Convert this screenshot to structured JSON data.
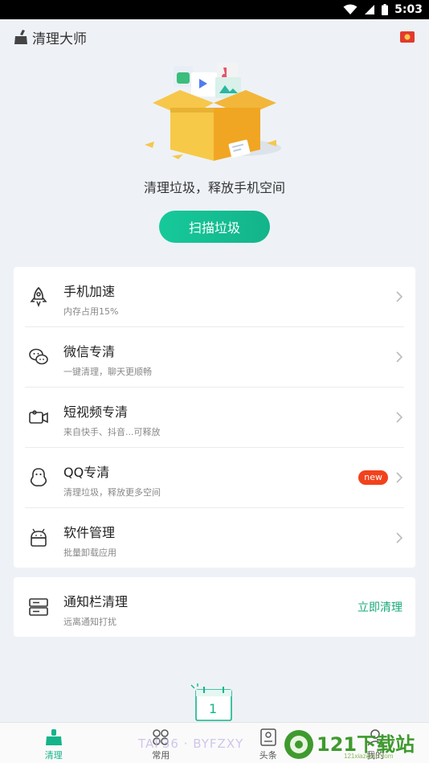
{
  "status_bar": {
    "time": "5:03"
  },
  "app_bar": {
    "title": "清理大师"
  },
  "hero": {
    "slogan": "清理垃圾，释放手机空间",
    "scan_button": "扫描垃圾"
  },
  "features": [
    {
      "title": "手机加速",
      "subtitle": "内存占用15%",
      "icon": "rocket-icon"
    },
    {
      "title": "微信专清",
      "subtitle": "一键清理，聊天更顺畅",
      "icon": "wechat-icon"
    },
    {
      "title": "短视频专清",
      "subtitle": "来自快手、抖音...可释放",
      "icon": "video-camera-icon"
    },
    {
      "title": "QQ专清",
      "subtitle": "清理垃圾，释放更多空间",
      "icon": "qq-penguin-icon",
      "badge": "new"
    },
    {
      "title": "软件管理",
      "subtitle": "批量卸载应用",
      "icon": "android-icon"
    }
  ],
  "notification_card": {
    "title": "通知栏清理",
    "subtitle": "远离通知打扰",
    "action": "立即清理",
    "icon": "notification-bar-icon"
  },
  "calendar_widget": {
    "day": "1"
  },
  "tabs": [
    {
      "label": "清理",
      "icon": "broom-icon",
      "active": true
    },
    {
      "label": "常用",
      "icon": "grid-icon",
      "active": false
    },
    {
      "label": "头条",
      "icon": "news-icon",
      "active": false
    },
    {
      "label": "我的",
      "icon": "profile-icon",
      "active": false
    }
  ],
  "watermark": {
    "text": "TAF36 · BYFZXY",
    "logo_text": "121下载站",
    "url": "121xiazaiwu.com"
  },
  "colors": {
    "accent": "#14b48a",
    "badge": "#f2421c",
    "background": "#eef2f7"
  }
}
